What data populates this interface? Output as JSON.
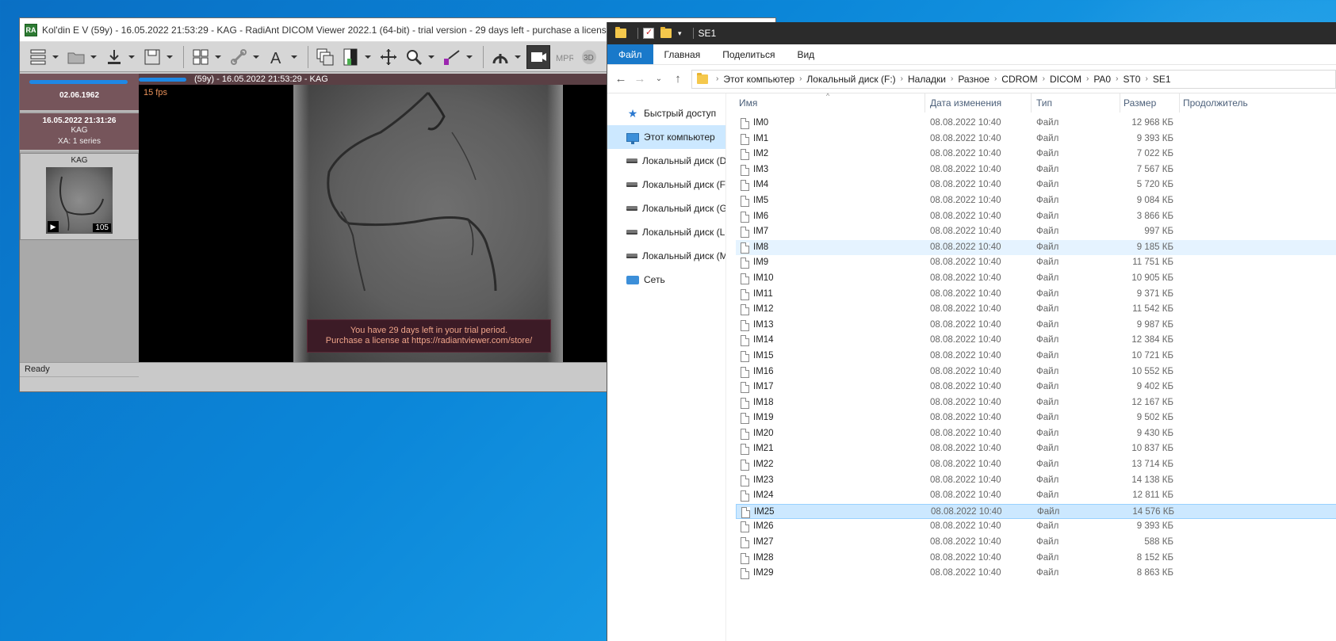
{
  "radiant": {
    "title": "Kol'din E V (59y) - 16.05.2022 21:53:29 - KAG - RadiAnt DICOM Viewer 2022.1 (64-bit) - trial version - 29 days left - purchase a license at https://radia",
    "app_icon": "RA",
    "patient": {
      "dob": "02.06.1962",
      "name": "Kol'din E V"
    },
    "study": {
      "datetime": "16.05.2022 21:31:26",
      "description": "KAG",
      "series_count": "XA: 1 series"
    },
    "series": {
      "label": "KAG",
      "frames": "105"
    },
    "viewport_header": "(59y) - 16.05.2022 21:53:29 - KAG",
    "fps": "15 fps",
    "trial_line1": "You have 29 days left in your trial period.",
    "trial_line2": "Purchase a license at https://radiantviewer.com/store/",
    "status": "Ready"
  },
  "explorer": {
    "title": "SE1",
    "ribbon_tabs": [
      "Файл",
      "Главная",
      "Поделиться",
      "Вид"
    ],
    "breadcrumb": [
      "Этот компьютер",
      "Локальный диск (F:)",
      "Наладки",
      "Разное",
      "CDROM",
      "DICOM",
      "PA0",
      "ST0",
      "SE1"
    ],
    "nav": [
      {
        "label": "Быстрый доступ",
        "icon": "star-icon"
      },
      {
        "label": "Этот компьютер",
        "icon": "computer-icon"
      },
      {
        "label": "Локальный диск (D:)",
        "icon": "disk-icon"
      },
      {
        "label": "Локальный диск (F:)",
        "icon": "disk-icon"
      },
      {
        "label": "Локальный диск (G:)",
        "icon": "disk-icon"
      },
      {
        "label": "Локальный диск (L:)",
        "icon": "disk-icon"
      },
      {
        "label": "Локальный диск (M:)",
        "icon": "disk-icon"
      },
      {
        "label": "Сеть",
        "icon": "network-icon"
      }
    ],
    "columns": {
      "name": "Имя",
      "date": "Дата изменения",
      "type": "Тип",
      "size": "Размер",
      "duration": "Продолжитель"
    },
    "files": [
      {
        "name": "IM0",
        "date": "08.08.2022 10:40",
        "type": "Файл",
        "size": "12 968 КБ"
      },
      {
        "name": "IM1",
        "date": "08.08.2022 10:40",
        "type": "Файл",
        "size": "9 393 КБ"
      },
      {
        "name": "IM2",
        "date": "08.08.2022 10:40",
        "type": "Файл",
        "size": "7 022 КБ"
      },
      {
        "name": "IM3",
        "date": "08.08.2022 10:40",
        "type": "Файл",
        "size": "7 567 КБ"
      },
      {
        "name": "IM4",
        "date": "08.08.2022 10:40",
        "type": "Файл",
        "size": "5 720 КБ"
      },
      {
        "name": "IM5",
        "date": "08.08.2022 10:40",
        "type": "Файл",
        "size": "9 084 КБ"
      },
      {
        "name": "IM6",
        "date": "08.08.2022 10:40",
        "type": "Файл",
        "size": "3 866 КБ"
      },
      {
        "name": "IM7",
        "date": "08.08.2022 10:40",
        "type": "Файл",
        "size": "997 КБ"
      },
      {
        "name": "IM8",
        "date": "08.08.2022 10:40",
        "type": "Файл",
        "size": "9 185 КБ"
      },
      {
        "name": "IM9",
        "date": "08.08.2022 10:40",
        "type": "Файл",
        "size": "11 751 КБ"
      },
      {
        "name": "IM10",
        "date": "08.08.2022 10:40",
        "type": "Файл",
        "size": "10 905 КБ"
      },
      {
        "name": "IM11",
        "date": "08.08.2022 10:40",
        "type": "Файл",
        "size": "9 371 КБ"
      },
      {
        "name": "IM12",
        "date": "08.08.2022 10:40",
        "type": "Файл",
        "size": "11 542 КБ"
      },
      {
        "name": "IM13",
        "date": "08.08.2022 10:40",
        "type": "Файл",
        "size": "9 987 КБ"
      },
      {
        "name": "IM14",
        "date": "08.08.2022 10:40",
        "type": "Файл",
        "size": "12 384 КБ"
      },
      {
        "name": "IM15",
        "date": "08.08.2022 10:40",
        "type": "Файл",
        "size": "10 721 КБ"
      },
      {
        "name": "IM16",
        "date": "08.08.2022 10:40",
        "type": "Файл",
        "size": "10 552 КБ"
      },
      {
        "name": "IM17",
        "date": "08.08.2022 10:40",
        "type": "Файл",
        "size": "9 402 КБ"
      },
      {
        "name": "IM18",
        "date": "08.08.2022 10:40",
        "type": "Файл",
        "size": "12 167 КБ"
      },
      {
        "name": "IM19",
        "date": "08.08.2022 10:40",
        "type": "Файл",
        "size": "9 502 КБ"
      },
      {
        "name": "IM20",
        "date": "08.08.2022 10:40",
        "type": "Файл",
        "size": "9 430 КБ"
      },
      {
        "name": "IM21",
        "date": "08.08.2022 10:40",
        "type": "Файл",
        "size": "10 837 КБ"
      },
      {
        "name": "IM22",
        "date": "08.08.2022 10:40",
        "type": "Файл",
        "size": "13 714 КБ"
      },
      {
        "name": "IM23",
        "date": "08.08.2022 10:40",
        "type": "Файл",
        "size": "14 138 КБ"
      },
      {
        "name": "IM24",
        "date": "08.08.2022 10:40",
        "type": "Файл",
        "size": "12 811 КБ"
      },
      {
        "name": "IM25",
        "date": "08.08.2022 10:40",
        "type": "Файл",
        "size": "14 576 КБ"
      },
      {
        "name": "IM26",
        "date": "08.08.2022 10:40",
        "type": "Файл",
        "size": "9 393 КБ"
      },
      {
        "name": "IM27",
        "date": "08.08.2022 10:40",
        "type": "Файл",
        "size": "588 КБ"
      },
      {
        "name": "IM28",
        "date": "08.08.2022 10:40",
        "type": "Файл",
        "size": "8 152 КБ"
      },
      {
        "name": "IM29",
        "date": "08.08.2022 10:40",
        "type": "Файл",
        "size": "8 863 КБ"
      }
    ],
    "hover_file": "IM8",
    "selected_file": "IM25"
  }
}
